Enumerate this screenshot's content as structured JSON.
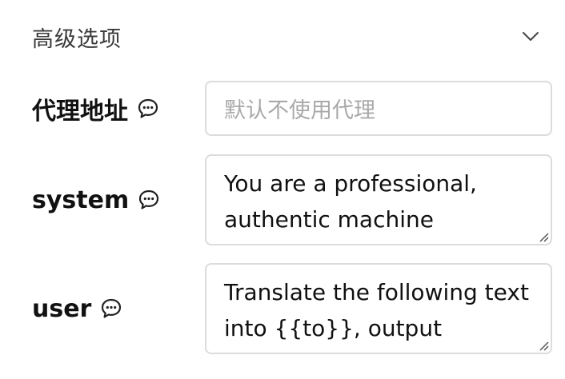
{
  "section": {
    "title": "高级选项",
    "expanded": true,
    "toggle_icon": "chevron-down-icon"
  },
  "fields": {
    "proxy": {
      "label": "代理地址",
      "help_icon": "comment-icon",
      "value": "",
      "placeholder": "默认不使用代理"
    },
    "system": {
      "label": "system",
      "help_icon": "comment-icon",
      "value": "You are a professional, authentic machine"
    },
    "user": {
      "label": "user",
      "help_icon": "comment-icon",
      "value": "Translate the following text into {{to}}, output"
    }
  }
}
